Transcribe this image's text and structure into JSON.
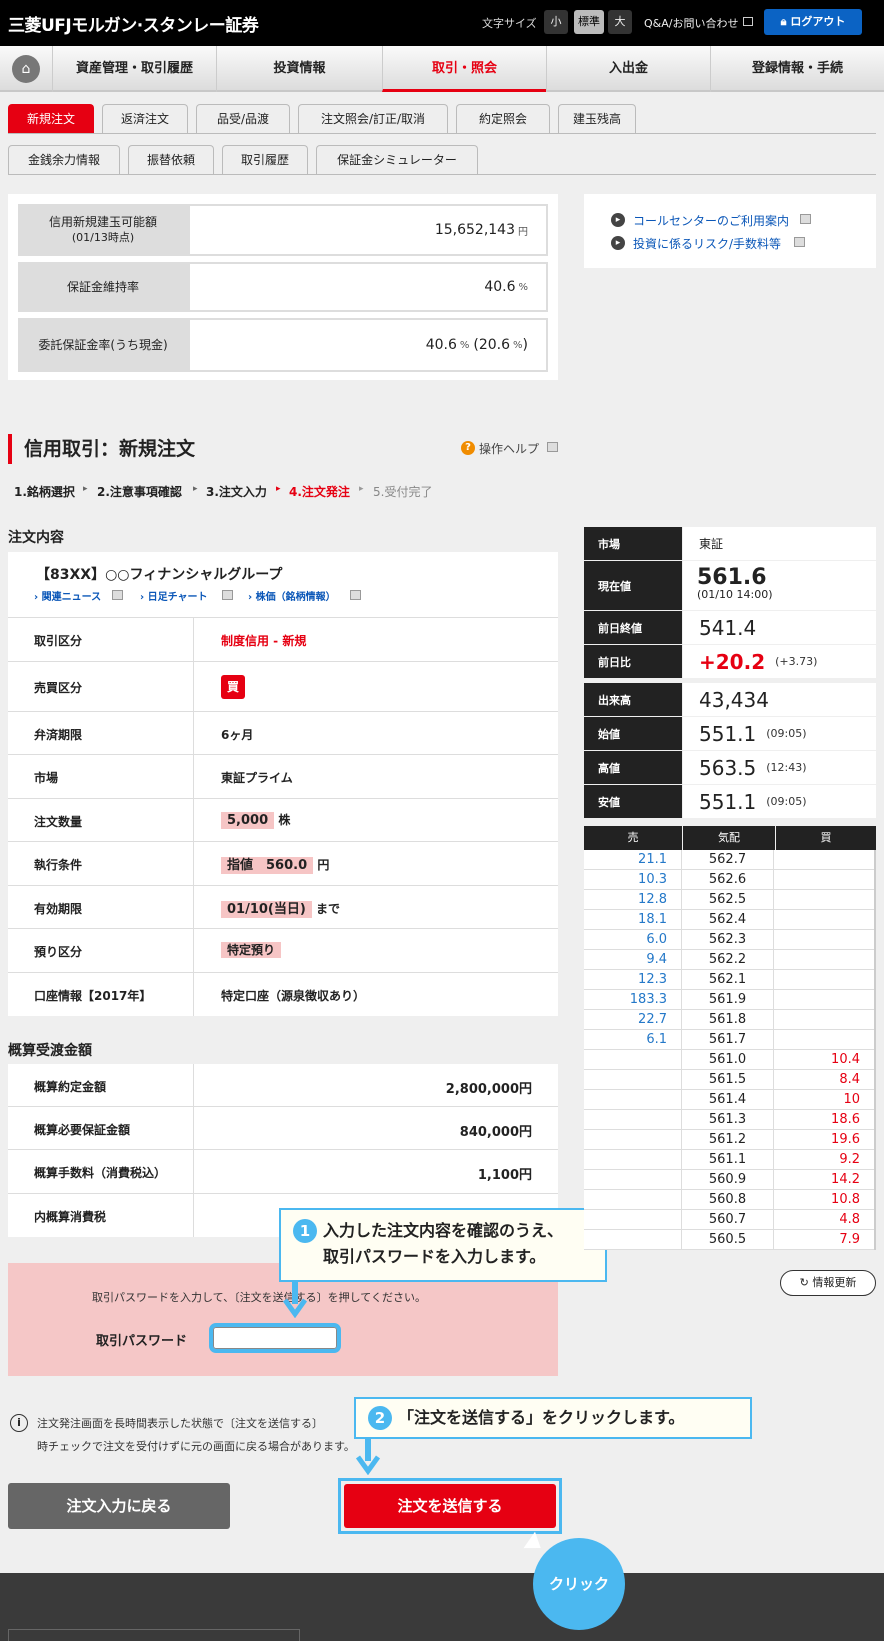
{
  "header": {
    "logo": "三菱UFJモルガン·スタンレー証券",
    "font_size_label": "文字サイズ",
    "font_sizes": [
      "小",
      "標準",
      "大"
    ],
    "qa": "Q&A/お問い合わせ",
    "logout": "ログアウト"
  },
  "nav": {
    "items": [
      "資産管理・取引履歴",
      "投資情報",
      "取引・照会",
      "入出金",
      "登録情報・手続"
    ]
  },
  "tabs1": [
    "新規注文",
    "返済注文",
    "品受/品渡",
    "注文照会/訂正/取消",
    "約定照会",
    "建玉残高"
  ],
  "tabs2": [
    "金銭余力情報",
    "振替依頼",
    "取引履歴",
    "保証金シミュレーター"
  ],
  "summary": {
    "r1_label": "信用新規建玉可能額",
    "r1_sub": "(01/13時点)",
    "r1_value": "15,652,143",
    "r1_unit": "円",
    "r2_label": "保証金維持率",
    "r2_value": "40.6",
    "r2_unit": "%",
    "r3_label": "委託保証金率(うち現金)",
    "r3_value": "40.6",
    "r3_unit": "%",
    "r3_paren_open": "(20.6",
    "r3_paren_close": ")"
  },
  "links": {
    "l1": "コールセンターのご利用案内",
    "l2": "投資に係るリスク/手数料等"
  },
  "page": {
    "title": "信用取引：新規注文",
    "help": "操作ヘルプ",
    "steps": [
      "1.銘柄選択",
      "2.注意事項確認",
      "3.注文入力",
      "4.注文発注",
      "5.受付完了"
    ]
  },
  "order": {
    "section": "注文内容",
    "stock": "【83XX】○○フィナンシャルグループ",
    "sublinks": [
      "関連ニュース",
      "日足チャート",
      "株価（銘柄情報）"
    ],
    "rows": [
      {
        "label": "取引区分",
        "value": "制度信用 - 新規"
      },
      {
        "label": "売買区分",
        "value": "買"
      },
      {
        "label": "弁済期限",
        "value": "6ヶ月"
      },
      {
        "label": "市場",
        "value": "東証プライム"
      },
      {
        "label": "注文数量",
        "value": "5,000",
        "suffix": "株"
      },
      {
        "label": "執行条件",
        "value": "指値　560.0",
        "suffix": "円"
      },
      {
        "label": "有効期限",
        "value": "01/10(当日)",
        "suffix": "まで"
      },
      {
        "label": "預り区分",
        "value": "特定預り"
      },
      {
        "label": "口座情報【2017年】",
        "value": "特定口座（源泉徴収あり）"
      }
    ]
  },
  "estimate": {
    "section": "概算受渡金額",
    "rows": [
      {
        "label": "概算約定金額",
        "value": "2,800,000円"
      },
      {
        "label": "概算必要保証金額",
        "value": "840,000円"
      },
      {
        "label": "概算手数料（消費税込）",
        "value": "1,100円"
      },
      {
        "label": "内概算消費税",
        "value": ""
      }
    ]
  },
  "password": {
    "instruction": "取引パスワードを入力して、〔注文を送信する〕を押してください。",
    "label": "取引パスワード",
    "value": ""
  },
  "notice": {
    "line1": "注文発注画面を長時間表示した状態で〔注文を送信する〕",
    "line2": "時チェックで注文を受付けずに元の画面に戻る場合があります。"
  },
  "buttons": {
    "back": "注文入力に戻る",
    "send": "注文を送信する",
    "refresh": "情報更新"
  },
  "callouts": {
    "c1_num": "1",
    "c1_line1": "入力した注文内容を確認のうえ、",
    "c1_line2": "取引パスワードを入力します。",
    "c2_num": "2",
    "c2_text": "「注文を送信する」をクリックします。",
    "click": "クリック"
  },
  "quote": {
    "market_label": "市場",
    "market": "東証",
    "current_label": "現在値",
    "current": "561.6",
    "current_time": "(01/10 14:00)",
    "prev_label": "前日終値",
    "prev": "541.4",
    "change_label": "前日比",
    "change": "+20.2",
    "change_pct": "(+3.73)",
    "volume_label": "出来高",
    "volume": "43,434",
    "open_label": "始値",
    "open": "551.1",
    "open_time": "(09:05)",
    "high_label": "高値",
    "high": "563.5",
    "high_time": "(12:43)",
    "low_label": "安値",
    "low": "551.1",
    "low_time": "(09:05)"
  },
  "orderbook": {
    "headers": [
      "売",
      "気配",
      "買"
    ],
    "rows": [
      [
        "21.1",
        "562.7",
        ""
      ],
      [
        "10.3",
        "562.6",
        ""
      ],
      [
        "12.8",
        "562.5",
        ""
      ],
      [
        "18.1",
        "562.4",
        ""
      ],
      [
        "6.0",
        "562.3",
        ""
      ],
      [
        "9.4",
        "562.2",
        ""
      ],
      [
        "12.3",
        "562.1",
        ""
      ],
      [
        "183.3",
        "561.9",
        ""
      ],
      [
        "22.7",
        "561.8",
        ""
      ],
      [
        "6.1",
        "561.7",
        ""
      ],
      [
        "",
        "561.0",
        "10.4"
      ],
      [
        "",
        "561.5",
        "8.4"
      ],
      [
        "",
        "561.4",
        "10"
      ],
      [
        "",
        "561.3",
        "18.6"
      ],
      [
        "",
        "561.2",
        "19.6"
      ],
      [
        "",
        "561.1",
        "9.2"
      ],
      [
        "",
        "560.9",
        "14.2"
      ],
      [
        "",
        "560.8",
        "10.8"
      ],
      [
        "",
        "560.7",
        "4.8"
      ],
      [
        "",
        "560.5",
        "7.9"
      ]
    ]
  },
  "colors": {
    "accent": "#e60012",
    "callout": "#4bb8f0",
    "blue_link": "#0b57b8"
  }
}
